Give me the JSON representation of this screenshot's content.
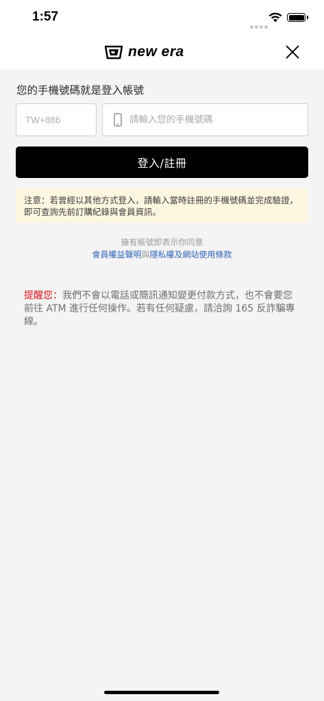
{
  "status_bar": {
    "time": "1:57"
  },
  "header": {
    "brand": "NEW ERA",
    "close_icon": "close-icon"
  },
  "login": {
    "title": "您的手機號碼就是登入帳號",
    "country_code_placeholder": "TW+886",
    "phone_placeholder": "請輸入您的手機號碼",
    "button_label": "登入/註冊"
  },
  "notice": {
    "text": "注意：若曾經以其他方式登入，請輸入當時註冊的手機號碼並完成驗證，即可查詢先前訂購紀錄與會員資訊。"
  },
  "agreement": {
    "prefix": "擁有帳號即表示你同意",
    "link_member": "會員權益聲明",
    "joiner": "與",
    "link_privacy": "隱私權及網站使用條款"
  },
  "warning": {
    "label": "提醒您：",
    "text": "我們不會以電話或簡訊通知變更付款方式，也不會要您前往 ATM 進行任何操作。若有任何疑慮，請洽詢 165 反詐騙專線。"
  },
  "colors": {
    "accent": "#000000",
    "link": "#2f63b8",
    "warning": "#d4141a",
    "notice_bg": "#fdf7e1"
  }
}
